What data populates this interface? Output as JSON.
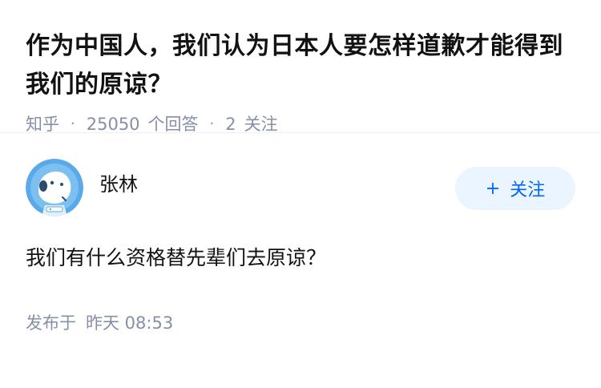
{
  "question": {
    "title": "作为中国人，我们认为日本人要怎样道歉才能得到我们的原谅？",
    "source": "知乎",
    "answer_count": "25050",
    "answer_count_label": "个回答",
    "follower_count": "2",
    "follower_label": "关注",
    "separator": "·"
  },
  "answer": {
    "author_name": "张林",
    "follow_button": {
      "plus": "+",
      "label": "关注"
    },
    "content": "我们有什么资格替先辈们去原谅？",
    "published_label": "发布于",
    "published_time": "昨天 08:53"
  },
  "colors": {
    "accent": "#0066ff",
    "follow_bg": "#ebf5ff",
    "meta_text": "#8590a6",
    "avatar_bg": "#5aa9e8"
  },
  "icons": {
    "avatar": "default-avatar-icon"
  }
}
